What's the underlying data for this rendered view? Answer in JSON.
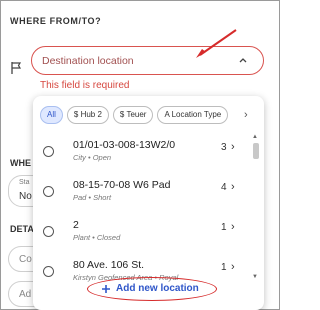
{
  "section": {
    "title": "WHERE FROM/TO?"
  },
  "destination": {
    "placeholder": "Destination location",
    "error": "This field is required"
  },
  "background_fragments": [
    "WHE",
    "Sta",
    "No",
    "DETA",
    "Co",
    "Ad"
  ],
  "filters": [
    {
      "label": "All",
      "active": true
    },
    {
      "label": "$ Hub 2",
      "active": false
    },
    {
      "label": "$ Teuer",
      "active": false
    },
    {
      "label": "A Location Type",
      "active": false
    }
  ],
  "locations": [
    {
      "title": "01/01-03-008-13W2/0",
      "subtitle": "City • Open",
      "count": "3"
    },
    {
      "title": "08-15-70-08 W6 Pad",
      "subtitle": "Pad • Short",
      "count": "4"
    },
    {
      "title": "2",
      "subtitle": "Plant • Closed",
      "count": "1"
    },
    {
      "title": "80 Ave. 106 St.",
      "subtitle": "Kirstyn Geofenced Area • Royal",
      "count": "1"
    }
  ],
  "add_new_label": "Add new location",
  "colors": {
    "error": "#d6473f",
    "accent": "#2f56c9",
    "annotation": "#d62b2b"
  }
}
